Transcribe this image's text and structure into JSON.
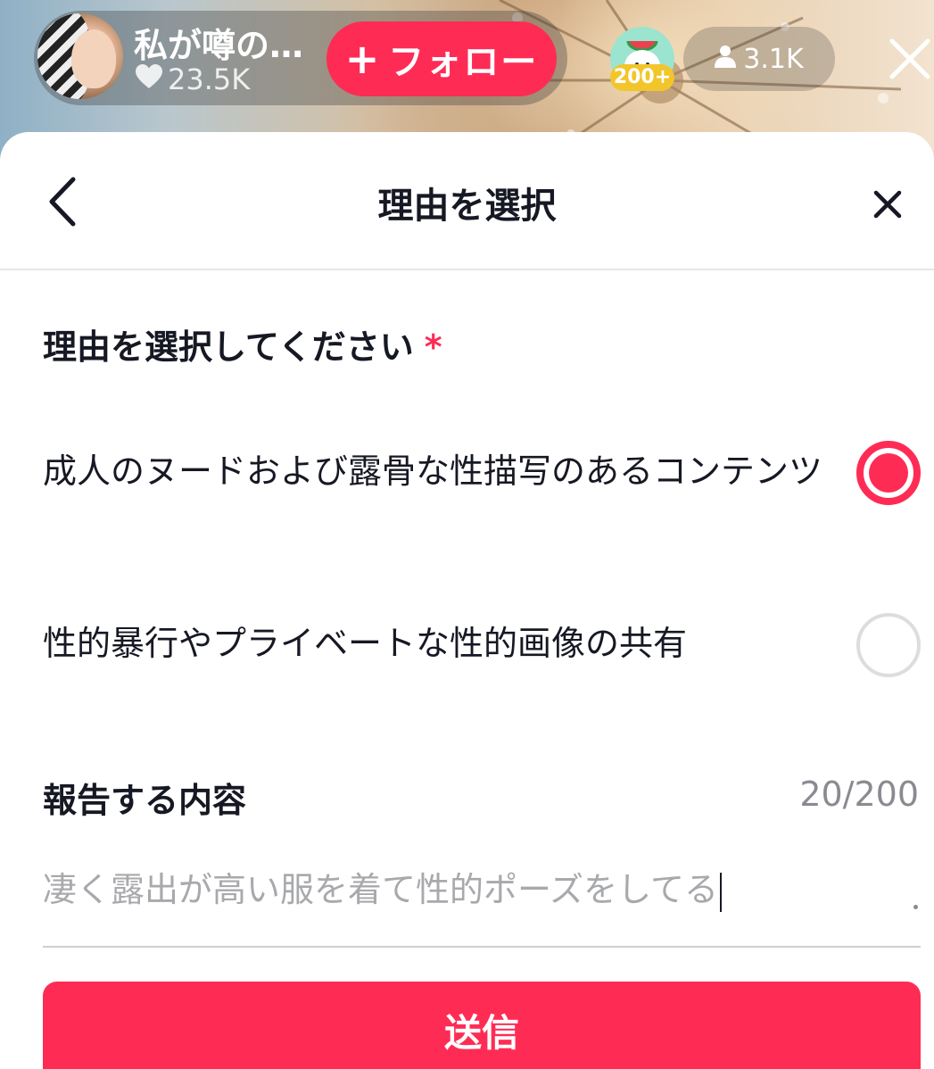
{
  "stream": {
    "host_name": "私が噂の…",
    "likes": "23.5K",
    "follow_label": "フォロー",
    "gift_count": "200+",
    "viewer_count": "3.1K"
  },
  "sheet": {
    "title": "理由を選択",
    "section_title": "理由を選択してください",
    "required_mark": "*",
    "options": [
      {
        "label": "成人のヌードおよび露骨な性描写のあるコンテンツ",
        "selected": true
      },
      {
        "label": "性的暴行やプライベートな性的画像の共有",
        "selected": false
      }
    ],
    "content_title": "報告する内容",
    "char_count": "20/200",
    "report_text": "凄く露出が高い服を着て性的ポーズをしてる",
    "submit_label": "送信"
  },
  "colors": {
    "accent": "#fe2c55",
    "text_primary": "#161823",
    "text_secondary": "#8a8b91"
  }
}
